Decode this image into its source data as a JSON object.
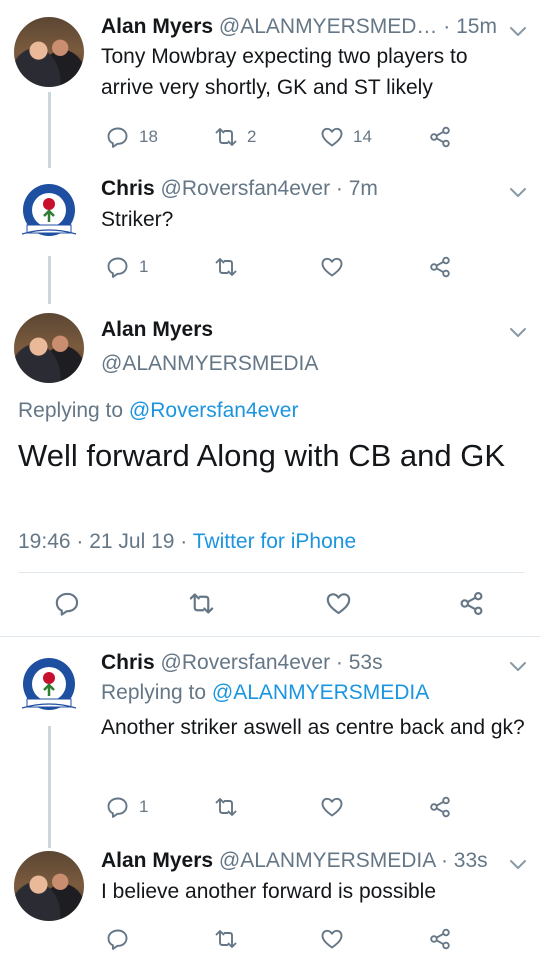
{
  "tweets": [
    {
      "name": "Alan Myers",
      "handle": "@ALANMYERSMED…",
      "time": " · 15m",
      "text": "Tony Mowbray expecting two players to arrive very shortly, GK and ST likely",
      "replies": "18",
      "retweets": "2",
      "likes": "14"
    },
    {
      "name": "Chris",
      "handle": "@Roversfan4ever",
      "time": " · 7m",
      "text": "Striker?",
      "replies": "1",
      "retweets": "",
      "likes": ""
    },
    {
      "name": "Chris",
      "handle": "@Roversfan4ever",
      "time": " · 53s",
      "replying_prefix": "Replying to ",
      "replying_to": "@ALANMYERSMEDIA",
      "text": "Another striker aswell as centre back and gk?",
      "replies": "1",
      "retweets": "",
      "likes": ""
    },
    {
      "name": "Alan Myers",
      "handle": "@ALANMYERSMEDIA",
      "time": " · 33s",
      "text": "I believe another forward is possible",
      "replies": "",
      "retweets": "",
      "likes": ""
    }
  ],
  "focused": {
    "name": "Alan Myers",
    "handle": "@ALANMYERSMEDIA",
    "replying_prefix": "Replying to ",
    "replying_to": "@Roversfan4ever",
    "text": "Well forward Along with CB and GK",
    "time": "19:46 · 21 Jul 19 · ",
    "source": "Twitter for iPhone"
  },
  "badge": {
    "ring_text": "BLACKBURN ROVERS F.C.",
    "year_left": "18",
    "year_right": "75",
    "motto": "ARTE ET LABORE"
  },
  "colors": {
    "link": "#1b95e0",
    "secondary": "#657786",
    "text": "#14171a",
    "thread_line": "#ccd6dd",
    "badge_blue": "#1f4fa0",
    "badge_rose": "#c8102e"
  },
  "icons": [
    "reply-icon",
    "retweet-icon",
    "like-icon",
    "share-icon",
    "chevron-down-icon"
  ]
}
